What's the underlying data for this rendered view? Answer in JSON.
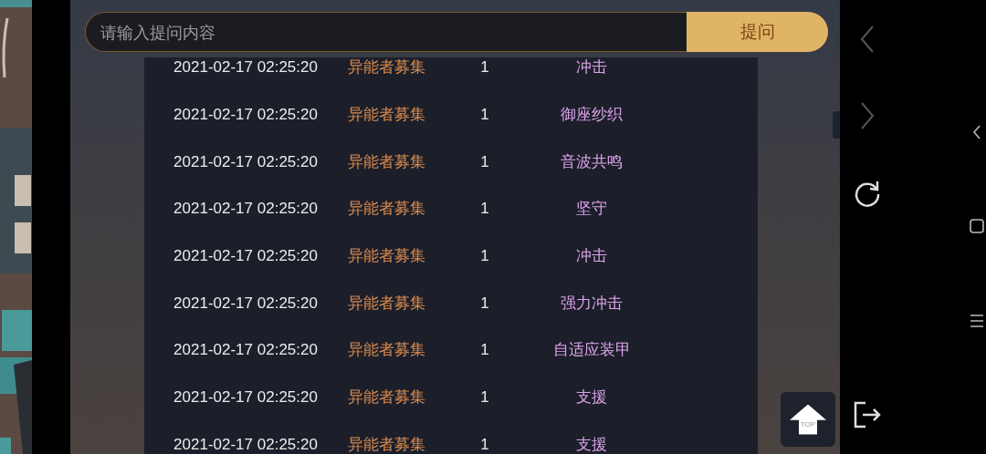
{
  "search": {
    "placeholder": "请输入提问内容",
    "button": "提问"
  },
  "rows": [
    {
      "time": "2021-02-17 02:25:20",
      "type": "异能者募集",
      "count": "1",
      "item": "冲击"
    },
    {
      "time": "2021-02-17 02:25:20",
      "type": "异能者募集",
      "count": "1",
      "item": "御座纱织"
    },
    {
      "time": "2021-02-17 02:25:20",
      "type": "异能者募集",
      "count": "1",
      "item": "音波共鸣"
    },
    {
      "time": "2021-02-17 02:25:20",
      "type": "异能者募集",
      "count": "1",
      "item": "坚守"
    },
    {
      "time": "2021-02-17 02:25:20",
      "type": "异能者募集",
      "count": "1",
      "item": "冲击"
    },
    {
      "time": "2021-02-17 02:25:20",
      "type": "异能者募集",
      "count": "1",
      "item": "强力冲击"
    },
    {
      "time": "2021-02-17 02:25:20",
      "type": "异能者募集",
      "count": "1",
      "item": "自适应装甲"
    },
    {
      "time": "2021-02-17 02:25:20",
      "type": "异能者募集",
      "count": "1",
      "item": "支援"
    },
    {
      "time": "2021-02-17 02:25:20",
      "type": "异能者募集",
      "count": "1",
      "item": "支援"
    }
  ],
  "top_button": "TOP"
}
